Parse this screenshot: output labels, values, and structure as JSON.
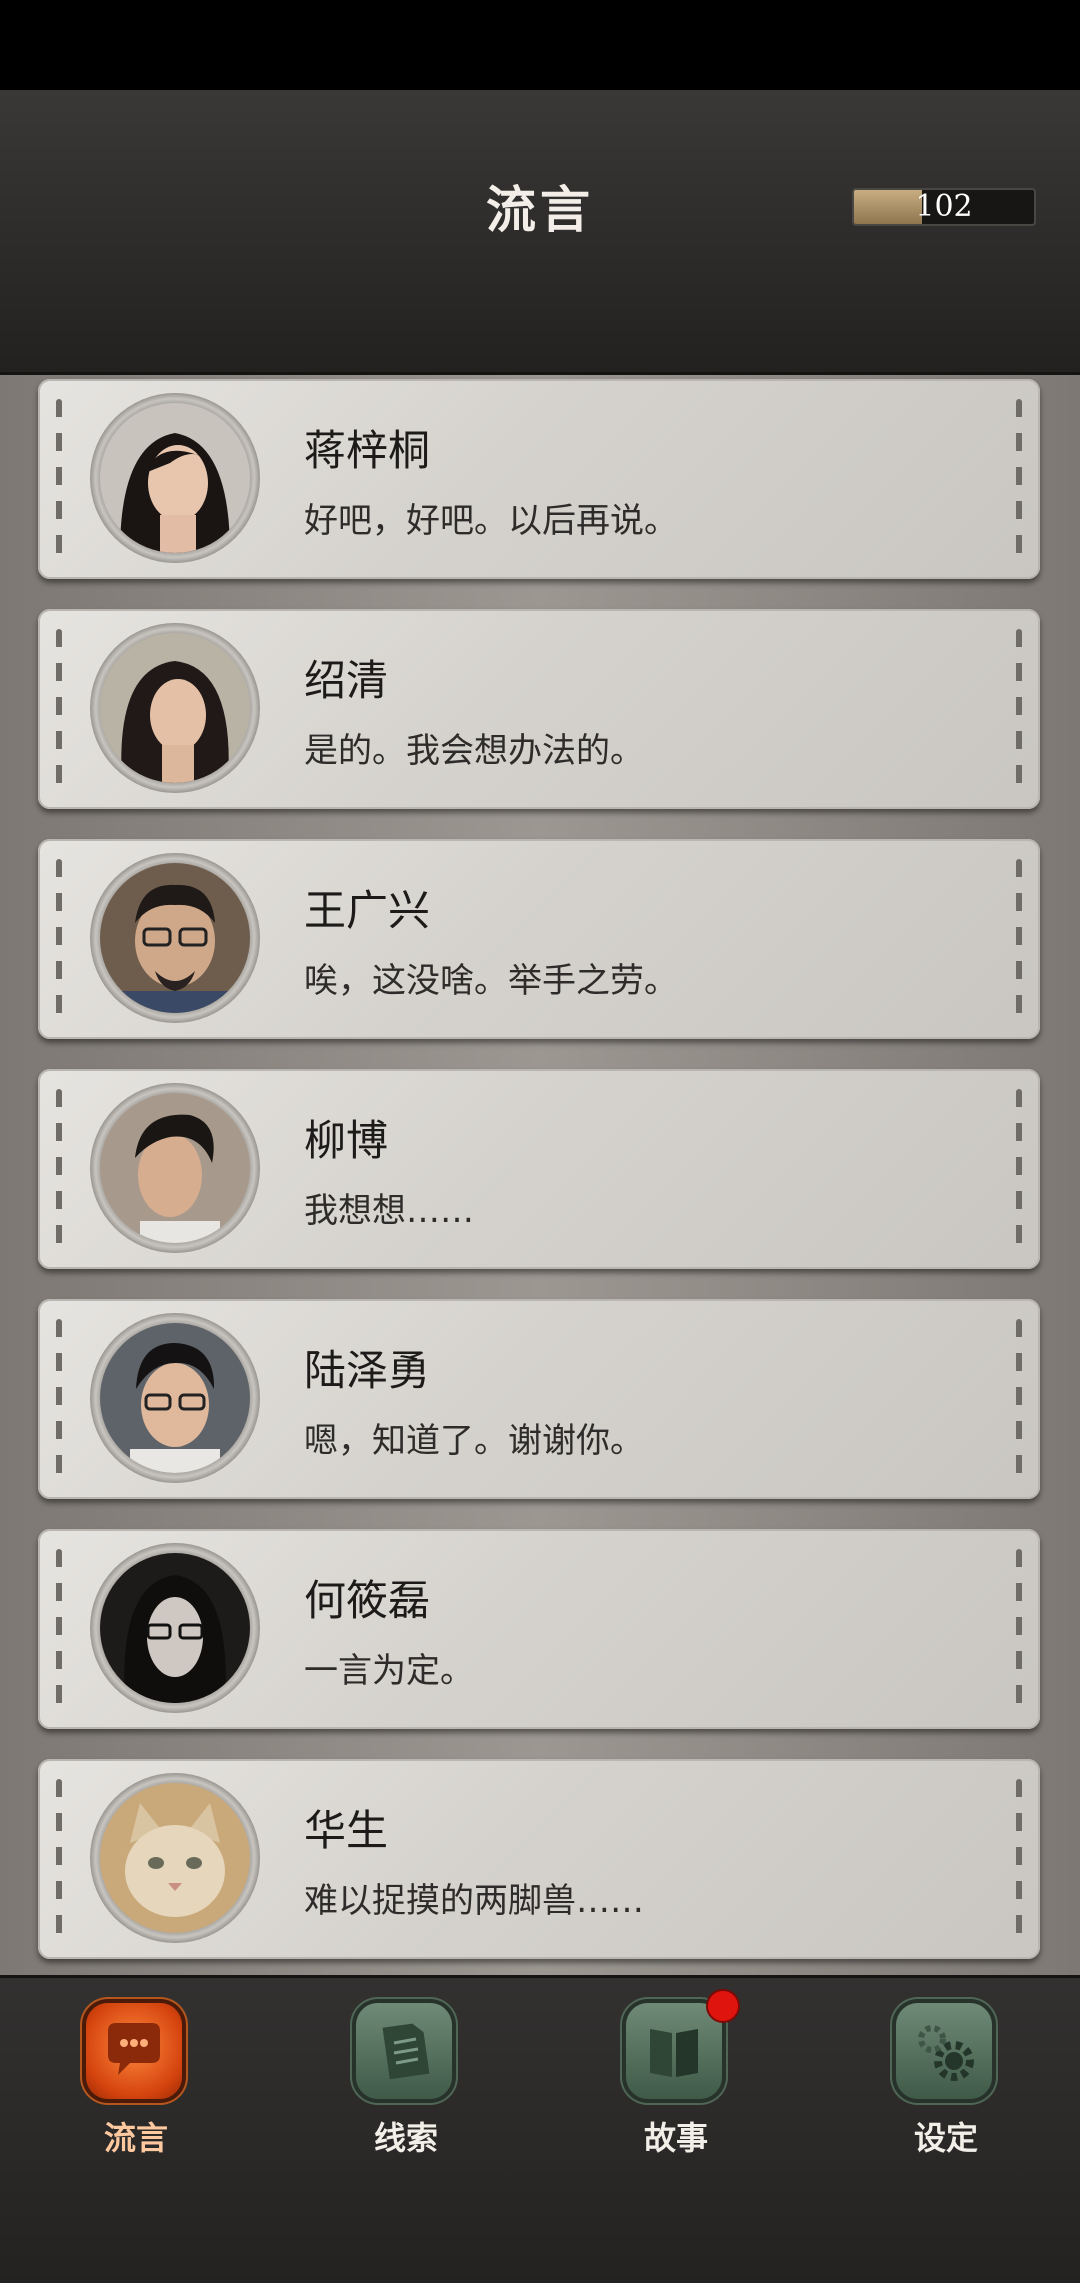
{
  "header": {
    "title": "流言",
    "currency_value": "102",
    "currency_fill_percent": 38
  },
  "contacts": [
    {
      "name": "蒋梓桐",
      "message": "好吧，好吧。以后再说。",
      "avatar_icon": "woman-avatar-icon"
    },
    {
      "name": "绍清",
      "message": "是的。我会想办法的。",
      "avatar_icon": "woman-avatar-icon"
    },
    {
      "name": "王广兴",
      "message": "唉，这没啥。举手之劳。",
      "avatar_icon": "man-glasses-avatar-icon"
    },
    {
      "name": "柳博",
      "message": "我想想……",
      "avatar_icon": "man-avatar-icon"
    },
    {
      "name": "陆泽勇",
      "message": "嗯，知道了。谢谢你。",
      "avatar_icon": "man-glasses-avatar-icon"
    },
    {
      "name": "何筱磊",
      "message": "一言为定。",
      "avatar_icon": "man-glasses-avatar-icon"
    },
    {
      "name": "华生",
      "message": "难以捉摸的两脚兽……",
      "avatar_icon": "cat-avatar-icon"
    }
  ],
  "nav": {
    "items": [
      {
        "label": "流言",
        "icon": "chat-icon",
        "active": true
      },
      {
        "label": "线索",
        "icon": "document-icon",
        "active": false
      },
      {
        "label": "故事",
        "icon": "book-icon",
        "active": false,
        "badge": true
      },
      {
        "label": "设定",
        "icon": "gear-icon",
        "active": false
      }
    ]
  },
  "colors": {
    "accent_active": "#d4430e",
    "badge": "#e0140e",
    "card": "#dcdad6",
    "header": "#2a2827"
  }
}
